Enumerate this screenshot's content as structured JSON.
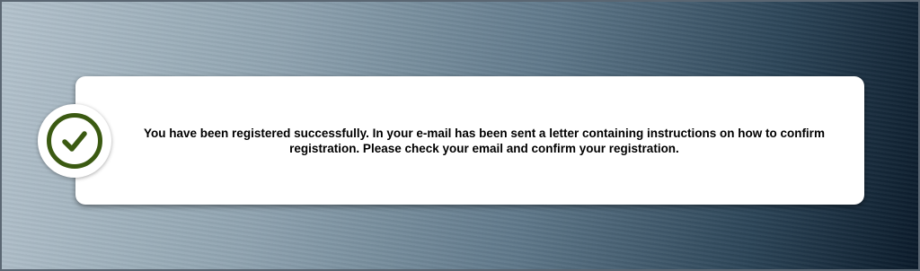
{
  "notification": {
    "message": "You have been registered successfully. In your e-mail has been sent a letter containing instructions on how to confirm registration. Please check your email and confirm your registration.",
    "status_icon": "check-circle-icon",
    "accent_color": "#3b5a12"
  }
}
